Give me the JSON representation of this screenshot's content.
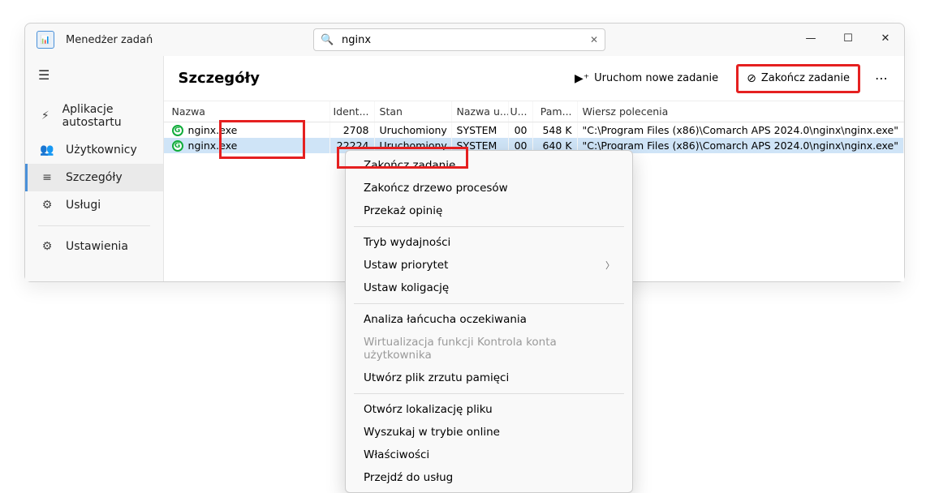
{
  "app": {
    "title": "Menedżer zadań"
  },
  "search": {
    "value": "nginx",
    "placeholder": ""
  },
  "sidebar": {
    "items": [
      {
        "icon": "⚡",
        "label": "Aplikacje autostartu"
      },
      {
        "icon": "👥",
        "label": "Użytkownicy"
      },
      {
        "icon": "≡",
        "label": "Szczegóły"
      },
      {
        "icon": "⚙",
        "label": "Usługi"
      }
    ],
    "settings": {
      "icon": "⚙",
      "label": "Ustawienia"
    }
  },
  "content": {
    "title": "Szczegóły",
    "actions": {
      "run": "Uruchom nowe zadanie",
      "end": "Zakończ zadanie"
    }
  },
  "columns": {
    "name": "Nazwa",
    "pid": "Ident...",
    "status": "Stan",
    "user": "Nazwa u...",
    "cpu": "U...",
    "mem": "Pam...",
    "cmd": "Wiersz polecenia"
  },
  "rows": [
    {
      "name": "nginx.exe",
      "pid": "2708",
      "status": "Uruchomiony",
      "user": "SYSTEM",
      "cpu": "00",
      "mem": "548 K",
      "cmd": "\"C:\\Program Files (x86)\\Comarch APS 2024.0\\nginx\\nginx.exe\""
    },
    {
      "name": "nginx.exe",
      "pid": "22224",
      "status": "Uruchomiony",
      "user": "SYSTEM",
      "cpu": "00",
      "mem": "640 K",
      "cmd": "\"C:\\Program Files (x86)\\Comarch APS 2024.0\\nginx\\nginx.exe\""
    }
  ],
  "context_menu": {
    "end_task": "Zakończ zadanie",
    "end_tree": "Zakończ drzewo procesów",
    "feedback": "Przekaż opinię",
    "efficiency": "Tryb wydajności",
    "priority": "Ustaw priorytet",
    "affinity": "Ustaw koligację",
    "wait_chain": "Analiza łańcucha oczekiwania",
    "uac": "Wirtualizacja funkcji Kontrola konta użytkownika",
    "dump": "Utwórz plik zrzutu pamięci",
    "open_loc": "Otwórz lokalizację pliku",
    "search_online": "Wyszukaj w trybie online",
    "properties": "Właściwości",
    "go_services": "Przejdź do usług"
  }
}
